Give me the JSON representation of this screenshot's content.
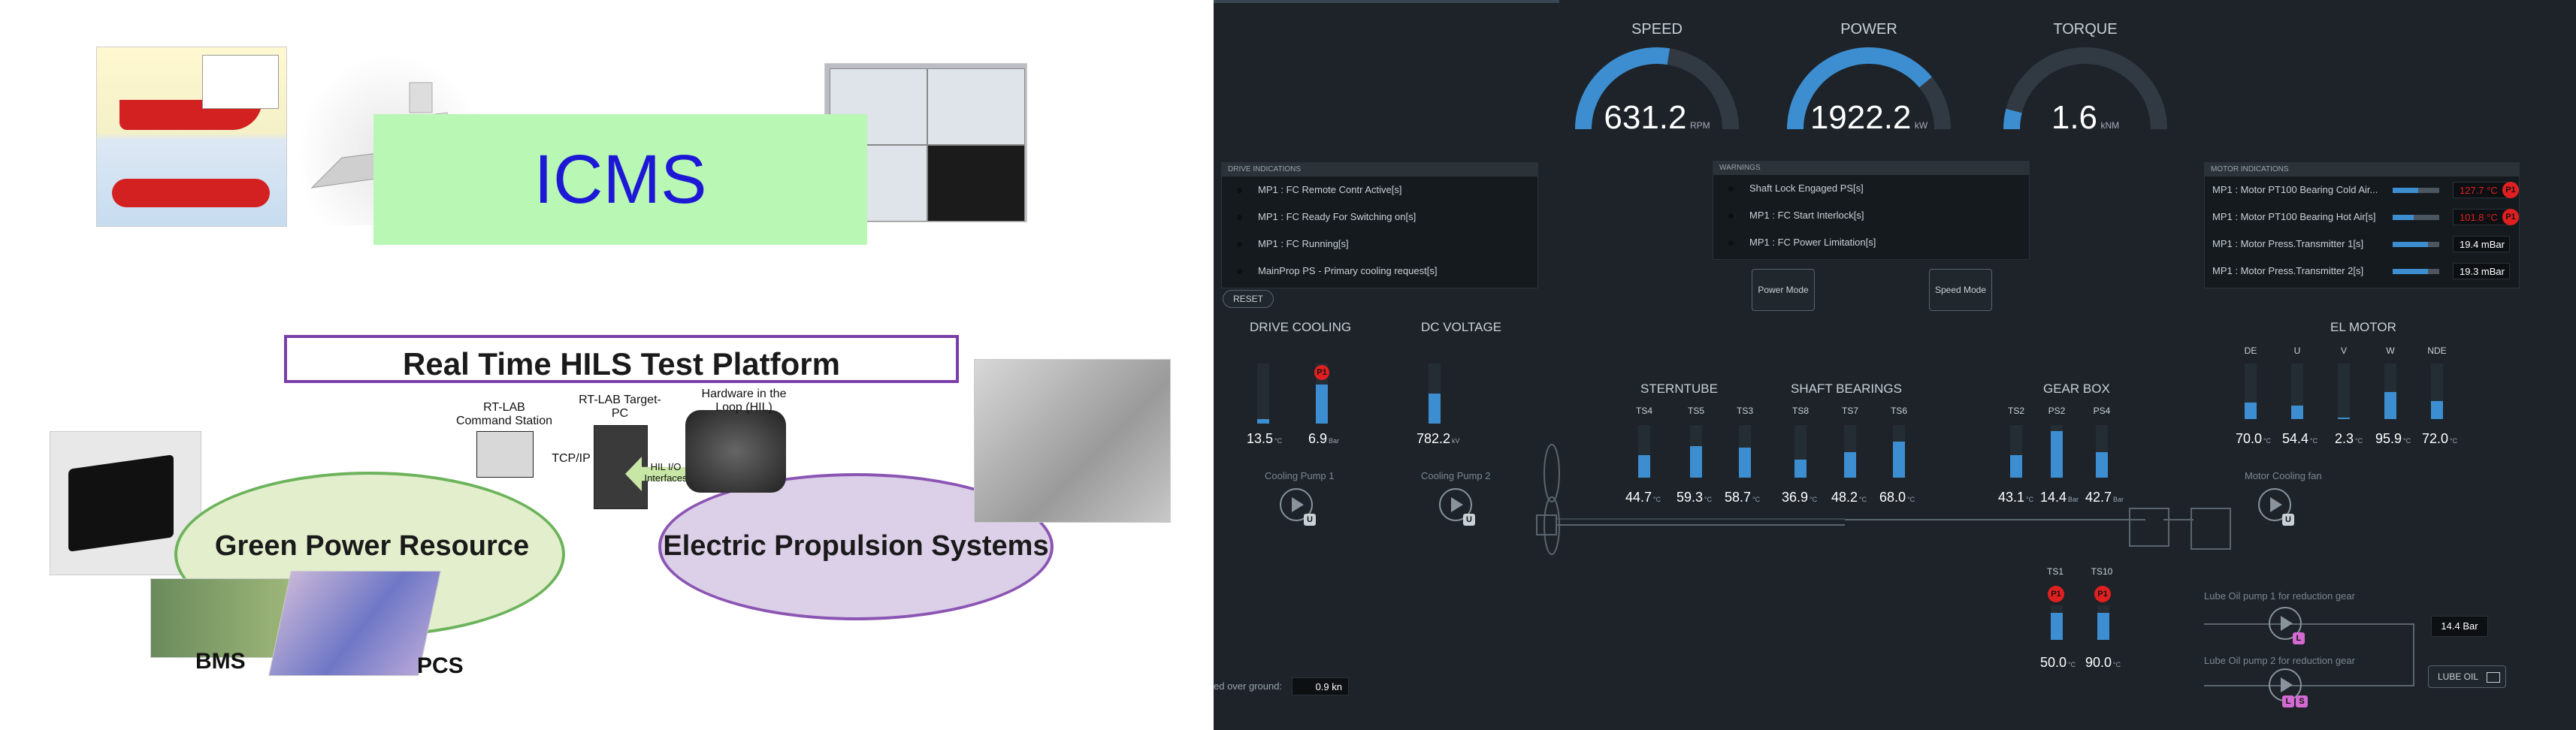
{
  "left_slide": {
    "title_box": "ICMS",
    "subtitle": "Real Time HILS Test Platform",
    "green_resource": "Green Power Resource",
    "electric_propulsion": "Electric Propulsion Systems",
    "bms": "BMS",
    "pcs": "PCS",
    "rtlab_cmd": "RT-LAB Command Station",
    "rtlab_target": "RT-LAB Target-PC",
    "hil": "Hardware in the Loop (HIL)",
    "tcpip": "TCP/IP",
    "hil_io": "HIL I/O Interfaces"
  },
  "gauges": [
    {
      "title": "SPEED",
      "value": "631.2",
      "unit": "RPM",
      "fraction": 0.55
    },
    {
      "title": "POWER",
      "value": "1922.2",
      "unit": "kW",
      "fraction": 0.78
    },
    {
      "title": "TORQUE",
      "value": "1.6",
      "unit": "kNM",
      "fraction": 0.08
    }
  ],
  "drive_indications": {
    "header": "DRIVE INDICATIONS",
    "items": [
      "MP1 : FC Remote Contr Active[s]",
      "MP1 : FC Ready For Switching on[s]",
      "MP1 : FC Running[s]",
      "MainProp PS - Primary cooling request[s]"
    ],
    "reset": "RESET"
  },
  "warnings": {
    "header": "WARNINGS",
    "items": [
      "Shaft Lock Engaged PS[s]",
      "MP1 : FC Start Interlock[s]",
      "MP1 : FC Power Limitation[s]"
    ],
    "power_mode": "Power Mode",
    "speed_mode": "Speed Mode"
  },
  "motor_indications": {
    "header": "MOTOR INDICATIONS",
    "items": [
      {
        "label": "MP1 : Motor PT100 Bearing Cold Air...",
        "value": "127.7 °C",
        "alarm": true,
        "fill": 0.55
      },
      {
        "label": "MP1 : Motor PT100 Bearing Hot Air[s]",
        "value": "101.8 °C",
        "alarm": true,
        "fill": 0.45
      },
      {
        "label": "MP1 : Motor Press.Transmitter 1[s]",
        "value": "19.4 mBar",
        "alarm": false,
        "fill": 0.75
      },
      {
        "label": "MP1 : Motor Press.Transmitter 2[s]",
        "value": "19.3 mBar",
        "alarm": false,
        "fill": 0.75
      }
    ]
  },
  "drive_cooling": {
    "title": "DRIVE COOLING",
    "v1": "13.5",
    "u1": "°C",
    "v2": "6.9",
    "u2": "Bar",
    "pump1": "Cooling Pump 1"
  },
  "dc_voltage": {
    "title": "DC VOLTAGE",
    "value": "782.2",
    "unit": "kV",
    "pump2": "Cooling Pump 2"
  },
  "sterntube": {
    "title": "STERNTUBE",
    "tags": [
      "TS4",
      "TS5",
      "TS3"
    ],
    "values": [
      "44.7",
      "59.3",
      "58.7"
    ]
  },
  "shaft_bearings": {
    "title": "SHAFT BEARINGS",
    "tags": [
      "TS8",
      "TS7",
      "TS6"
    ],
    "values": [
      "36.9",
      "48.2",
      "68.0"
    ]
  },
  "gear_box": {
    "title": "GEAR BOX",
    "tags": [
      "TS2",
      "PS2",
      "PS4"
    ],
    "values": [
      "43.1",
      "14.4",
      "42.7"
    ],
    "units": [
      "°C",
      "Bar",
      "Bar"
    ]
  },
  "gear_lower": {
    "tags": [
      "TS1",
      "TS10"
    ],
    "values": [
      "50.0",
      "90.0"
    ]
  },
  "el_motor": {
    "title": "EL MOTOR",
    "tags": [
      "DE",
      "U",
      "V",
      "W",
      "NDE"
    ],
    "values": [
      "70.0",
      "54.4",
      "2.3",
      "95.9",
      "72.0"
    ],
    "fan": "Motor Cooling fan"
  },
  "lube": {
    "pump1": "Lube Oil pump 1 for reduction gear",
    "pump2": "Lube Oil pump 2 for reduction gear",
    "pressure": "14.4 Bar",
    "button": "LUBE OIL"
  },
  "speed_ground": {
    "label": "ed over ground:",
    "value": "0.9 kn"
  },
  "colors": {
    "accent": "#3c8ed0",
    "alarm": "#e02020",
    "bg": "#1d2329"
  }
}
